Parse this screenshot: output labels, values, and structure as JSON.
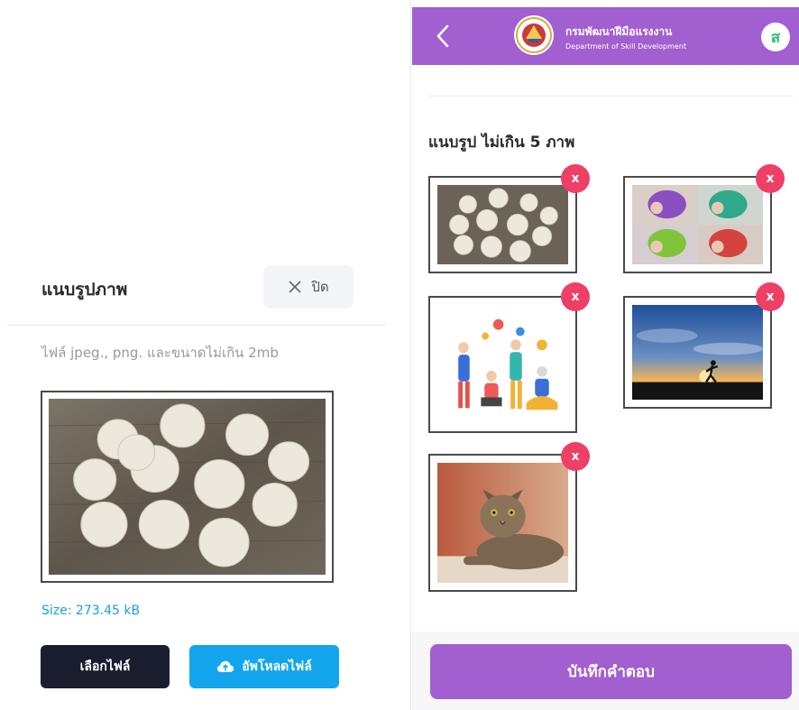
{
  "upload_modal": {
    "title": "แนบรูปภาพ",
    "close_label": "ปิด",
    "hint": "ไฟล์ jpeg., png. และขนาดไม่เกิน 2mb",
    "preview_image": "sand-dollar-cookies-photo",
    "size_text": "Size: 273.45 kB",
    "choose_file_label": "เลือกไฟล์",
    "upload_label": "อัพโหลดไฟล์"
  },
  "app_header": {
    "org_name_th": "กรมพัฒนาฝีมือแรงงาน",
    "org_name_en": "Department of Skill Development",
    "avatar_initial": "ส",
    "colors": {
      "primary": "#a15fcf",
      "remove": "#ee3f67",
      "upload": "#13a5ec",
      "dark_button": "#1a1d2e"
    }
  },
  "attachments": {
    "title": "แนบรูป ไม่เกิน 5 ภาพ",
    "remove_label": "x",
    "images": [
      {
        "content": "sand-dollar-cookies-photo"
      },
      {
        "content": "colorful-hair-collage-photo"
      },
      {
        "content": "people-illustration"
      },
      {
        "content": "runner-sunset-photo"
      },
      {
        "content": "tabby-cat-photo"
      }
    ]
  },
  "footer": {
    "save_label": "บันทึกคำตอบ"
  }
}
